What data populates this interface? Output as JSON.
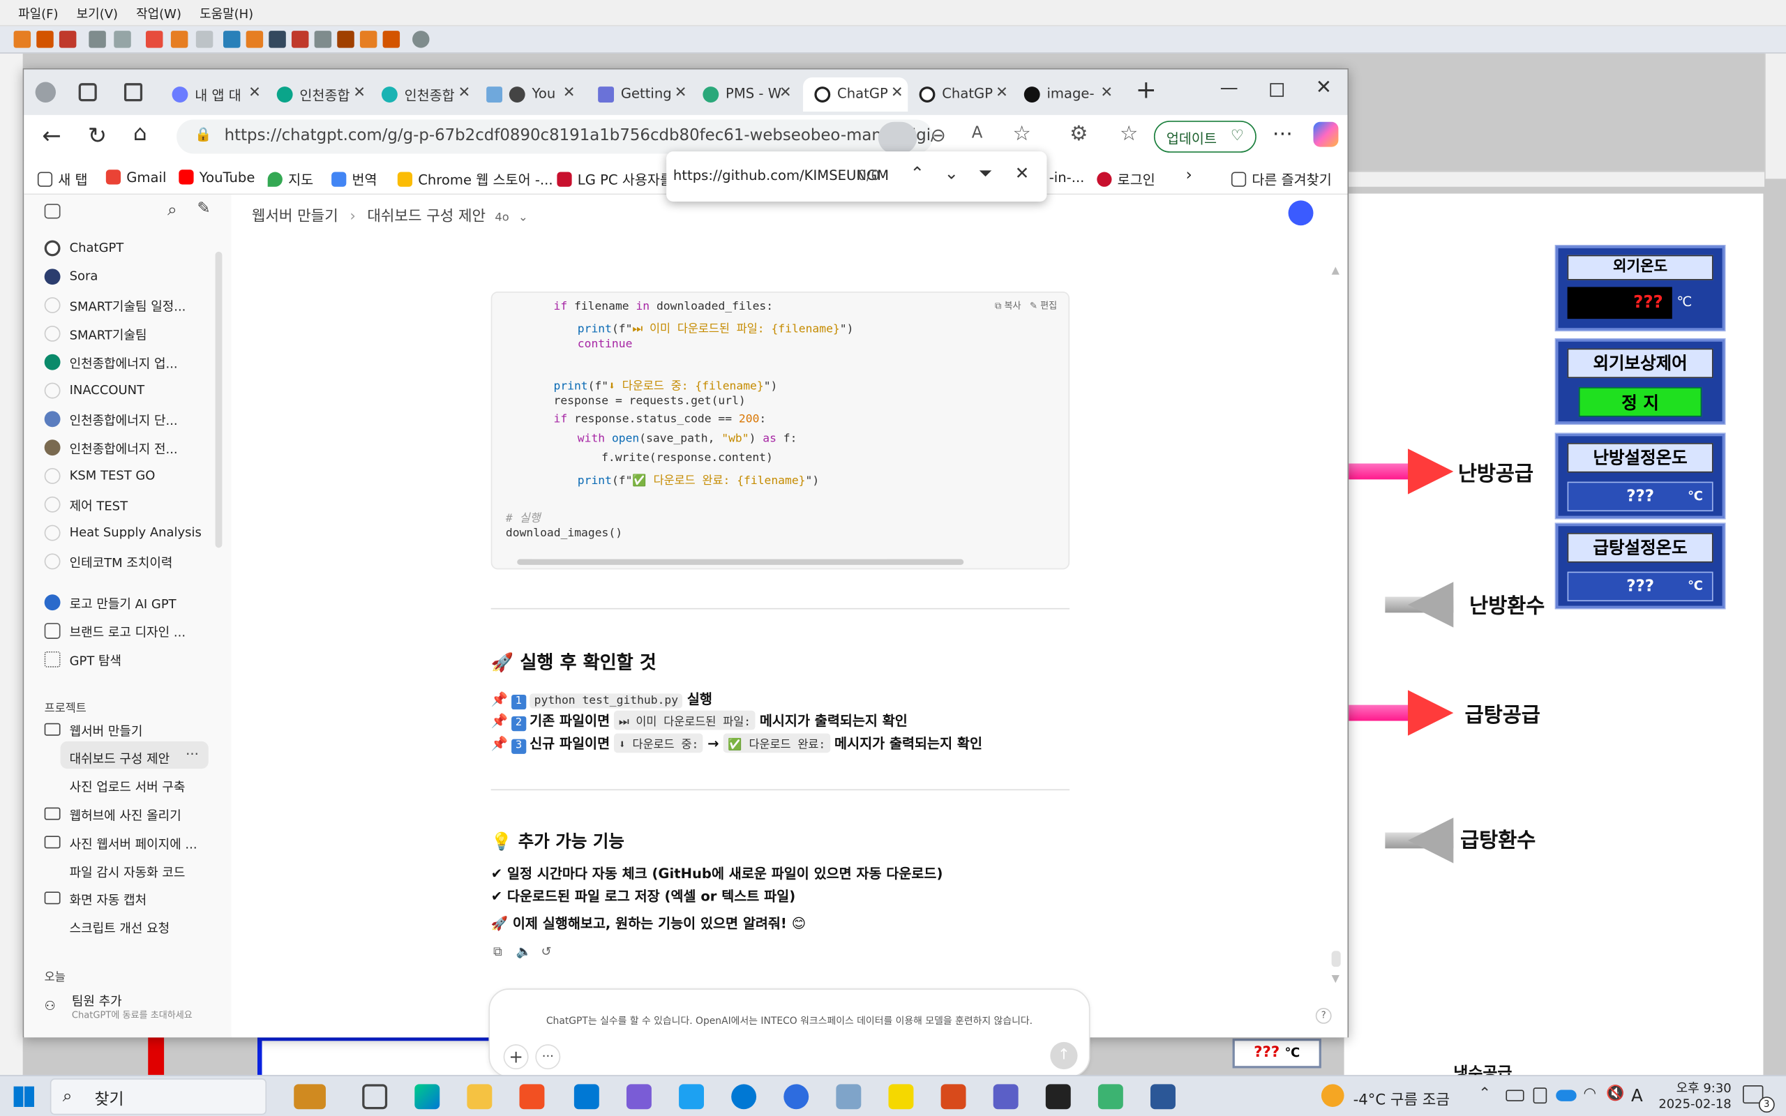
{
  "bg_app": {
    "menu": [
      "파일(F)",
      "보기(V)",
      "작업(W)",
      "도움말(H)"
    ],
    "hmi": {
      "outdoor_temp_title": "외기온도",
      "outdoor_temp_value": "???",
      "outdoor_temp_unit": "℃",
      "comp_control_title": "외기보상제어",
      "comp_control_state": "정 지",
      "heat_set_title": "난방설정온도",
      "heat_set_value": "???",
      "heat_set_unit": "℃",
      "hw_set_title": "급탕설정온도",
      "hw_set_value": "???",
      "hw_set_unit": "℃",
      "bottom_value": "???",
      "bottom_unit": "℃",
      "arrow_heating_supply": "난방공급",
      "arrow_heating_return": "난방환수",
      "arrow_hw_supply": "급탕공급",
      "arrow_hw_return": "급탕환수",
      "arrow_bottom_partial": "냉수공급"
    }
  },
  "browser": {
    "tabs": [
      {
        "label": "내 앱 대",
        "color": "#6b7cff"
      },
      {
        "label": "인천종합",
        "color": "#0aa58a"
      },
      {
        "label": "인천종합",
        "color": "#19b3b3"
      },
      {
        "label": "You",
        "color": "#444"
      },
      {
        "label": "Getting",
        "color": "#6a72d8"
      },
      {
        "label": "PMS - W",
        "color": "#2aa87a"
      },
      {
        "label": "ChatGP",
        "color": "#222"
      },
      {
        "label": "ChatGP",
        "color": "#222"
      },
      {
        "label": "image-",
        "color": "#111"
      }
    ],
    "url": "https://chatgpt.com/g/g-p-67b2cdf0890c8191a1b756cdb80fec61-webseobeo-mandeulgi/c/67b4...",
    "update_button": "업데이트",
    "bookmarks": [
      {
        "label": "새 탭",
        "color": "#444"
      },
      {
        "label": "Gmail",
        "color": "#ea4335"
      },
      {
        "label": "YouTube",
        "color": "#ff0000"
      },
      {
        "label": "지도",
        "color": "#34a853"
      },
      {
        "label": "번역",
        "color": "#4285f4"
      },
      {
        "label": "Chrome 웹 스토어 -...",
        "color": "#fbbc05"
      },
      {
        "label": "LG PC 사용자를",
        "color": "#c8102e"
      },
      {
        "label": "-in-...",
        "color": "#888"
      },
      {
        "label": "로그인",
        "color": "#c8102e"
      }
    ],
    "bookmarks_other": "다른 즐겨찾기",
    "find": {
      "query": "https://github.com/KIMSEUNGM",
      "count": "0/0"
    }
  },
  "sidebar": {
    "items": [
      {
        "label": "ChatGPT",
        "color": "#444"
      },
      {
        "label": "Sora",
        "color": "#2b3d6e"
      },
      {
        "label": "SMART기술팀 일정...",
        "color": "#ccc"
      },
      {
        "label": "SMART기술팀",
        "color": "#ccc"
      },
      {
        "label": "인천종합에너지 업...",
        "color": "#0a8a6a"
      },
      {
        "label": "INACCOUNT",
        "color": "#ccc"
      },
      {
        "label": "인천종합에너지 단...",
        "color": "#5a7dbf"
      },
      {
        "label": "인천종합에너지 전...",
        "color": "#7a6a50"
      },
      {
        "label": "KSM TEST GO",
        "color": "#ccc"
      },
      {
        "label": "제어 TEST",
        "color": "#ccc"
      },
      {
        "label": "Heat Supply Analysis",
        "color": "#ccc"
      },
      {
        "label": "인테코TM 조치이력",
        "color": "#ccc"
      },
      {
        "label": "로고 만들기 AI GPT",
        "color": "#2a6acb"
      },
      {
        "label": "브랜드 로고 디자인 ...",
        "color": "#555"
      },
      {
        "label": "GPT 탐색",
        "color": "#555"
      }
    ],
    "projects_heading": "프로젝트",
    "projects": [
      {
        "label": "웹서버 만들기",
        "folder": true
      },
      {
        "label": "대쉬보드 구성 제안",
        "folder": false,
        "active": true
      },
      {
        "label": "사진 업로드 서버 구축",
        "folder": false
      },
      {
        "label": "웹허브에 사진 올리기",
        "folder": true
      },
      {
        "label": "사진 웹서버 페이지에 ...",
        "folder": true
      },
      {
        "label": "파일 감시 자동화 코드",
        "folder": false
      },
      {
        "label": "화면 자동 캡처",
        "folder": true
      },
      {
        "label": "스크립트 개선 요청",
        "folder": false
      }
    ],
    "today_heading": "오늘",
    "team_add": "팀원 추가",
    "team_add_sub": "ChatGPT에 동료를 초대하세요"
  },
  "header": {
    "project": "웹서버 만들기",
    "chat": "대쉬보드 구성 제안",
    "model": "4o"
  },
  "code": {
    "copy": "복사",
    "edit": "편집",
    "l1_kw": "if",
    "l1_a": " filename ",
    "l1_in": "in",
    "l1_b": " downloaded_files:",
    "l2_fn": "print",
    "l2_a": "(f\"",
    "l2_str": "⏭ 이미 다운로드된 파일: {filename}",
    "l2_b": "\")",
    "l3": "continue",
    "l4_fn": "print",
    "l4_a": "(f\"",
    "l4_str": "⬇ 다운로드 중: {filename}",
    "l4_b": "\")",
    "l5": "response = requests.get(url)",
    "l6_kw": "if",
    "l6_a": " response.status_code == ",
    "l6_num": "200",
    "l6_b": ":",
    "l7_kw": "with",
    "l7_fn": " open",
    "l7_a": "(save_path, ",
    "l7_str": "\"wb\"",
    "l7_b": ") ",
    "l7_as": "as",
    "l7_c": " f:",
    "l8": "f.write(response.content)",
    "l9_fn": "print",
    "l9_a": "(f\"",
    "l9_str": "✅ 다운로드 완료: {filename}",
    "l9_b": "\")",
    "l10": "# 실행",
    "l11": "download_images()"
  },
  "msg": {
    "h1": "🚀 실행 후 확인할 것",
    "s1_pre": "📌",
    "s1_n": "1",
    "s1_code": "python test_github.py",
    "s1_txt": "실행",
    "s2_pre": "📌",
    "s2_n": "2",
    "s2_a": "기존 파일이면",
    "s2_code": "⏭ 이미 다운로드된 파일:",
    "s2_b": "메시지가 출력되는지 확인",
    "s3_pre": "📌",
    "s3_n": "3",
    "s3_a": "신규 파일이면",
    "s3_code1": "⬇ 다운로드 중:",
    "s3_arrow": "→",
    "s3_code2": "✅ 다운로드 완료:",
    "s3_b": "메시지가 출력되는지 확인",
    "h2": "💡 추가 가능 기능",
    "f1": "✔ 일정 시간마다 자동 체크 (GitHub에 새로운 파일이 있으면 자동 다운로드)",
    "f2": "✔ 다운로드된 파일 로그 저장 (엑셀 or 텍스트 파일)",
    "f3": "🚀 이제 실행해보고, 원하는 기능이 있으면 알려줘! 😊"
  },
  "disclaimer": "ChatGPT는 실수를 할 수 있습니다. OpenAI에서는 INTECO 워크스페이스 데이터를 이용해 모델을 훈련하지 않습니다.",
  "taskbar": {
    "search": "찾기",
    "weather": "-4°C 구름 조금",
    "ime": "A",
    "time": "오후 9:30",
    "date": "2025-02-18",
    "notif": "3"
  }
}
